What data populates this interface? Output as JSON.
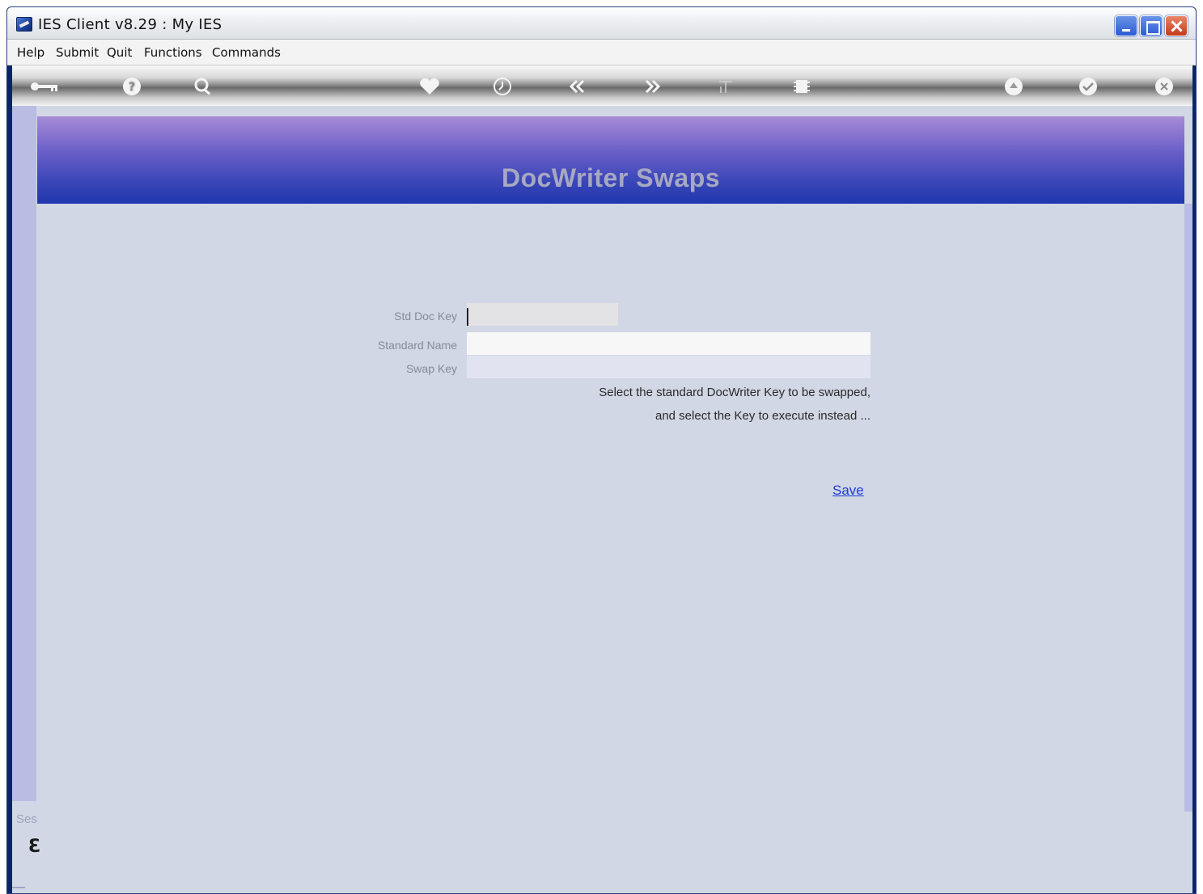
{
  "window": {
    "title": "IES Client v8.29 : My IES"
  },
  "menubar": {
    "items": [
      "Help",
      "Submit",
      "Quit",
      "Functions",
      "Commands"
    ]
  },
  "toolbar": {
    "icons": [
      "key-icon",
      "help-icon",
      "search-icon",
      "heart-icon",
      "clock-icon",
      "rewind-icon",
      "forward-icon",
      "text-icon",
      "chip-icon",
      "recycle-icon",
      "check-icon",
      "close-icon"
    ]
  },
  "page": {
    "title": "DocWriter Swaps"
  },
  "form": {
    "std_doc_key": {
      "label": "Std Doc Key",
      "value": ""
    },
    "standard_name": {
      "label": "Standard Name",
      "value": ""
    },
    "swap_key": {
      "label": "Swap Key",
      "value": ""
    }
  },
  "hint": {
    "line1": "Select the standard DocWriter Key to be swapped,",
    "line2": "and select the Key to execute instead ..."
  },
  "actions": {
    "save_label": "Save"
  },
  "footer": {
    "session_label": "Ses",
    "glyph": "Ɛ"
  }
}
